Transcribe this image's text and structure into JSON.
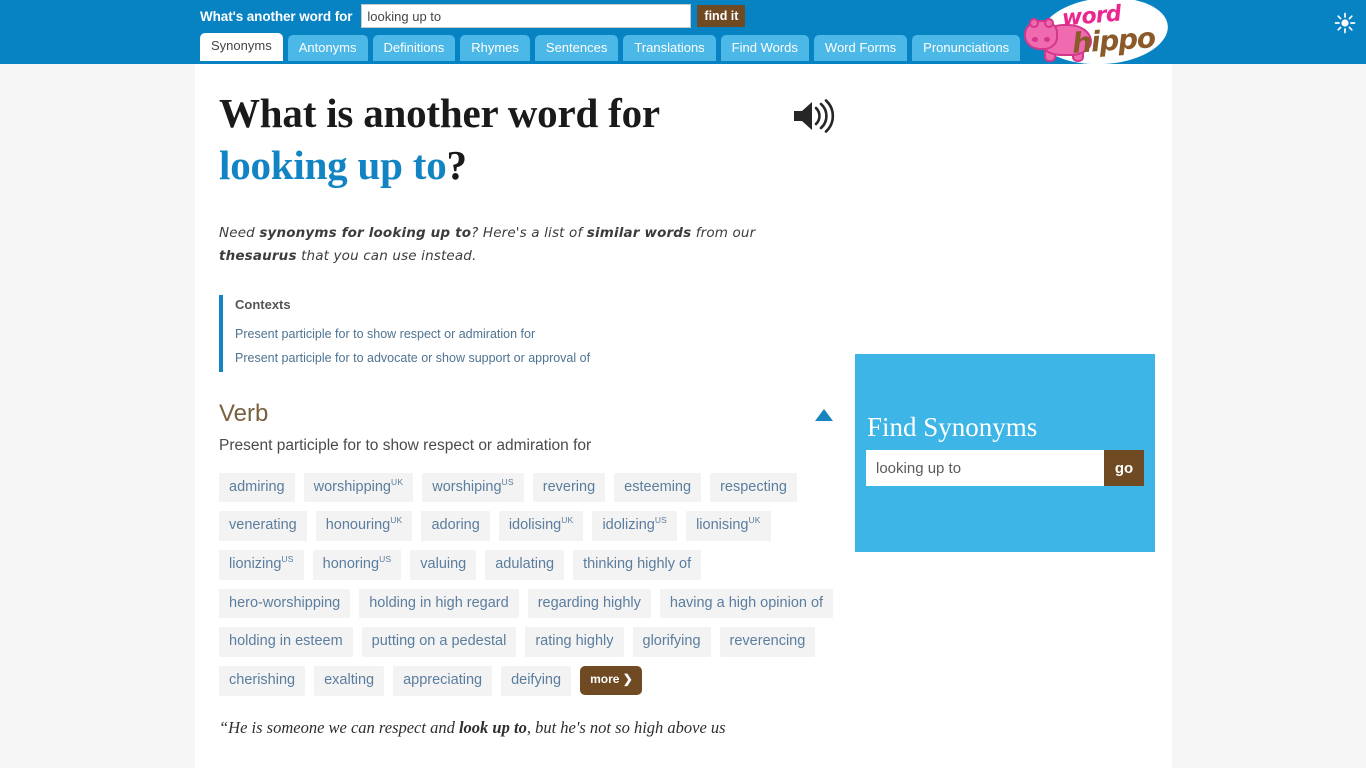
{
  "header": {
    "search_label": "What's another word for",
    "search_value": "looking up to",
    "find_button": "find it",
    "logo_word": "word",
    "logo_hippo": "hippo",
    "theme_icon": "sun-icon",
    "tabs": [
      {
        "label": "Synonyms",
        "active": true
      },
      {
        "label": "Antonyms",
        "active": false
      },
      {
        "label": "Definitions",
        "active": false
      },
      {
        "label": "Rhymes",
        "active": false
      },
      {
        "label": "Sentences",
        "active": false
      },
      {
        "label": "Translations",
        "active": false
      },
      {
        "label": "Find Words",
        "active": false
      },
      {
        "label": "Word Forms",
        "active": false
      },
      {
        "label": "Pronunciations",
        "active": false
      }
    ]
  },
  "main": {
    "headline_prefix": "What is another word for",
    "headline_term": "looking up to",
    "headline_qmark": "?",
    "speaker_icon": "speaker-icon",
    "lede_1": "Need ",
    "lede_2": "synonyms for looking up to",
    "lede_3": "? Here's a list of ",
    "lede_4": "similar words",
    "lede_5": " from our ",
    "lede_6": "thesaurus",
    "lede_7": " that you can use instead.",
    "contexts_title": "Contexts",
    "contexts": [
      "Present participle for to show respect or admiration for",
      "Present participle for to advocate or show support or approval of"
    ],
    "pos_title": "Verb",
    "pos_sense": "Present participle for to show respect or admiration for",
    "collapse_icon": "triangle-up-icon",
    "synonyms": [
      {
        "word": "admiring",
        "sup": ""
      },
      {
        "word": "worshipping",
        "sup": "UK"
      },
      {
        "word": "worshiping",
        "sup": "US"
      },
      {
        "word": "revering",
        "sup": ""
      },
      {
        "word": "esteeming",
        "sup": ""
      },
      {
        "word": "respecting",
        "sup": ""
      },
      {
        "word": "venerating",
        "sup": ""
      },
      {
        "word": "honouring",
        "sup": "UK"
      },
      {
        "word": "adoring",
        "sup": ""
      },
      {
        "word": "idolising",
        "sup": "UK"
      },
      {
        "word": "idolizing",
        "sup": "US"
      },
      {
        "word": "lionising",
        "sup": "UK"
      },
      {
        "word": "lionizing",
        "sup": "US"
      },
      {
        "word": "honoring",
        "sup": "US"
      },
      {
        "word": "valuing",
        "sup": ""
      },
      {
        "word": "adulating",
        "sup": ""
      },
      {
        "word": "thinking highly of",
        "sup": ""
      },
      {
        "word": "hero-worshipping",
        "sup": ""
      },
      {
        "word": "holding in high regard",
        "sup": ""
      },
      {
        "word": "regarding highly",
        "sup": ""
      },
      {
        "word": "having a high opinion of",
        "sup": ""
      },
      {
        "word": "holding in esteem",
        "sup": ""
      },
      {
        "word": "putting on a pedestal",
        "sup": ""
      },
      {
        "word": "rating highly",
        "sup": ""
      },
      {
        "word": "glorifying",
        "sup": ""
      },
      {
        "word": "reverencing",
        "sup": ""
      },
      {
        "word": "cherishing",
        "sup": ""
      },
      {
        "word": "exalting",
        "sup": ""
      },
      {
        "word": "appreciating",
        "sup": ""
      },
      {
        "word": "deifying",
        "sup": ""
      }
    ],
    "more_label": "more ❯",
    "quote_1": "“He is someone we can respect and ",
    "quote_2": "look up to",
    "quote_3": ", but he's not so high above us"
  },
  "sidebar": {
    "find_title": "Find Synonyms",
    "find_value": "looking up to",
    "go_label": "go"
  },
  "colors": {
    "header_blue": "#0782c3",
    "tab_blue": "#4cb8e8",
    "accent_blue": "#1284c4",
    "brown": "#6f4a23",
    "panel_blue": "#3db5e6",
    "chip_bg": "#f3f3f3",
    "chip_text": "#5b7d9e",
    "pos_brown": "#7a6240",
    "logo_pink": "#ec268f"
  }
}
